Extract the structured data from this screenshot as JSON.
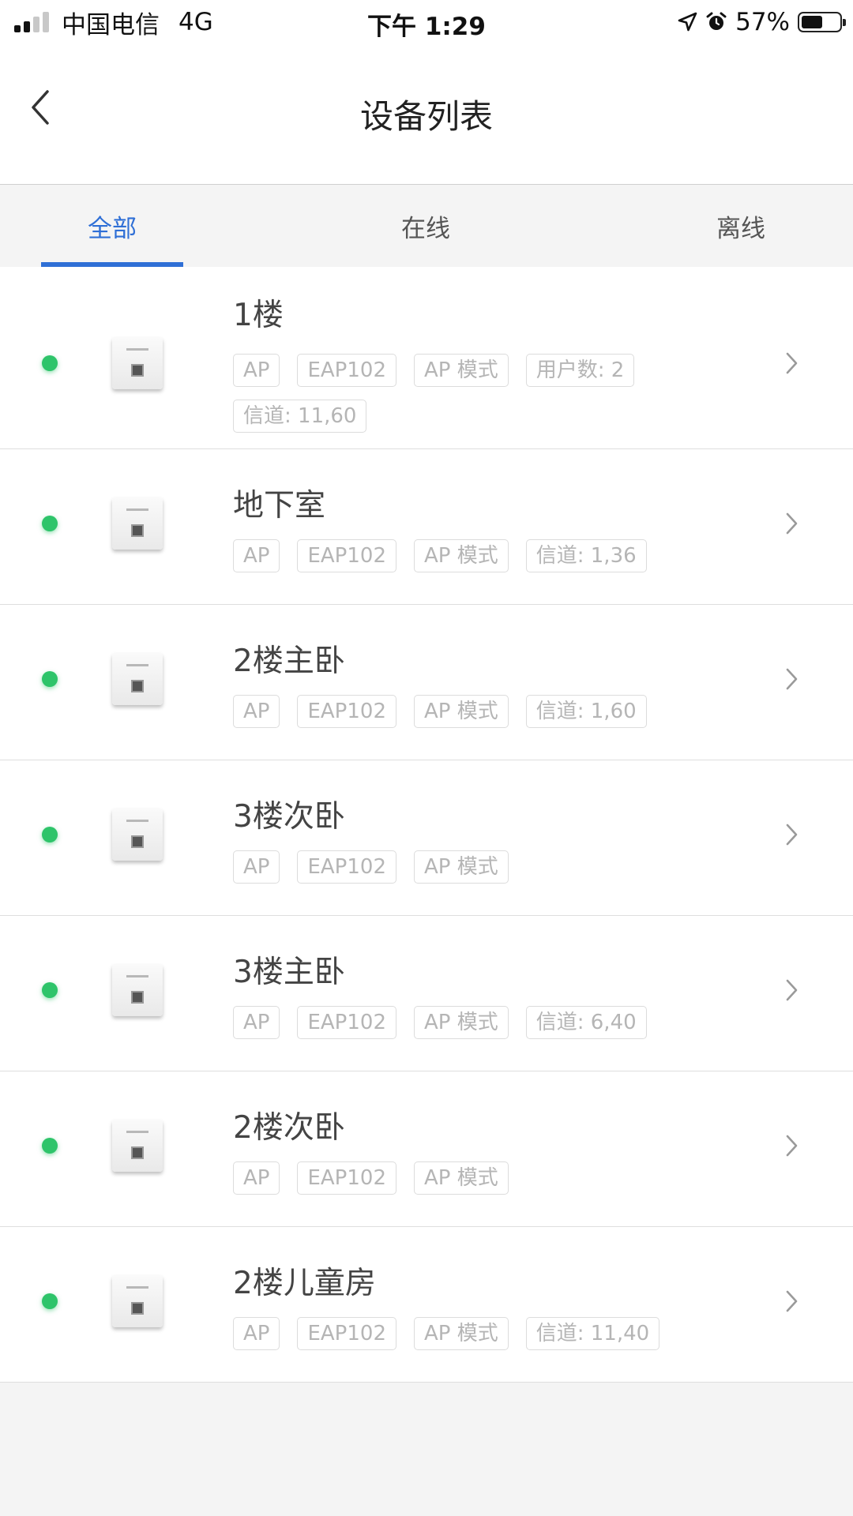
{
  "status_bar": {
    "carrier": "中国电信",
    "network": "4G",
    "time": "下午 1:29",
    "battery": "57%",
    "battery_level": 0.57,
    "icons": [
      "signal-icon",
      "location-icon",
      "alarm-icon",
      "battery-icon"
    ]
  },
  "nav": {
    "title": "设备列表",
    "back_icon": "chevron-left-icon"
  },
  "tabs": [
    {
      "label": "全部",
      "active": true
    },
    {
      "label": "在线",
      "active": false
    },
    {
      "label": "离线",
      "active": false
    }
  ],
  "colors": {
    "accent": "#2f6fd6",
    "online": "#2ec46a"
  },
  "devices": [
    {
      "name": "1楼",
      "tags": [
        "AP",
        "EAP102",
        "AP 模式",
        "用户数: 2",
        "信道: 11,60"
      ],
      "online": true
    },
    {
      "name": "地下室",
      "tags": [
        "AP",
        "EAP102",
        "AP 模式",
        "信道: 1,36"
      ],
      "online": true
    },
    {
      "name": "2楼主卧",
      "tags": [
        "AP",
        "EAP102",
        "AP 模式",
        "信道: 1,60"
      ],
      "online": true
    },
    {
      "name": "3楼次卧",
      "tags": [
        "AP",
        "EAP102",
        "AP 模式"
      ],
      "online": true
    },
    {
      "name": "3楼主卧",
      "tags": [
        "AP",
        "EAP102",
        "AP 模式",
        "信道: 6,40"
      ],
      "online": true
    },
    {
      "name": "2楼次卧",
      "tags": [
        "AP",
        "EAP102",
        "AP 模式"
      ],
      "online": true
    },
    {
      "name": "2楼儿童房",
      "tags": [
        "AP",
        "EAP102",
        "AP 模式",
        "信道: 11,40"
      ],
      "online": true
    }
  ]
}
